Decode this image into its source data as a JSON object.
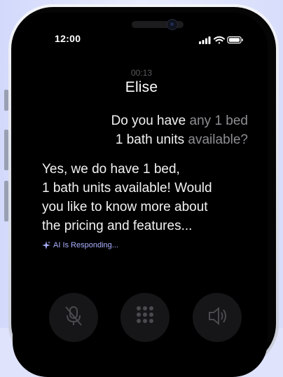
{
  "status_bar": {
    "time": "12:00"
  },
  "call": {
    "timer": "00:13",
    "caller_name": "Elise"
  },
  "transcript": {
    "user_message": [
      {
        "text": "Do you have ",
        "tone": "w"
      },
      {
        "text": "any 1 bed",
        "tone": "g"
      },
      {
        "text": "\n",
        "tone": "br"
      },
      {
        "text": "1 bath units ",
        "tone": "w"
      },
      {
        "text": "available?",
        "tone": "g"
      }
    ],
    "ai_message": [
      {
        "text": "Yes, we do have 1 bed,",
        "tone": "w"
      },
      {
        "text": "\n",
        "tone": "br"
      },
      {
        "text": "1 bath units available! Would",
        "tone": "w"
      },
      {
        "text": "\n",
        "tone": "br"
      },
      {
        "text": "you like to know more about",
        "tone": "w"
      },
      {
        "text": "\n",
        "tone": "br"
      },
      {
        "text": "the pricing and features...",
        "tone": "w"
      }
    ],
    "ai_status": "AI Is Responding..."
  },
  "controls": [
    {
      "name": "mute-button",
      "icon": "mic-off-icon"
    },
    {
      "name": "keypad-button",
      "icon": "keypad-icon"
    },
    {
      "name": "speaker-button",
      "icon": "speaker-icon"
    }
  ],
  "colors": {
    "accent": "#a9b1ff",
    "primary_text": "#f2f2f2",
    "secondary_text": "#8e8e93"
  }
}
